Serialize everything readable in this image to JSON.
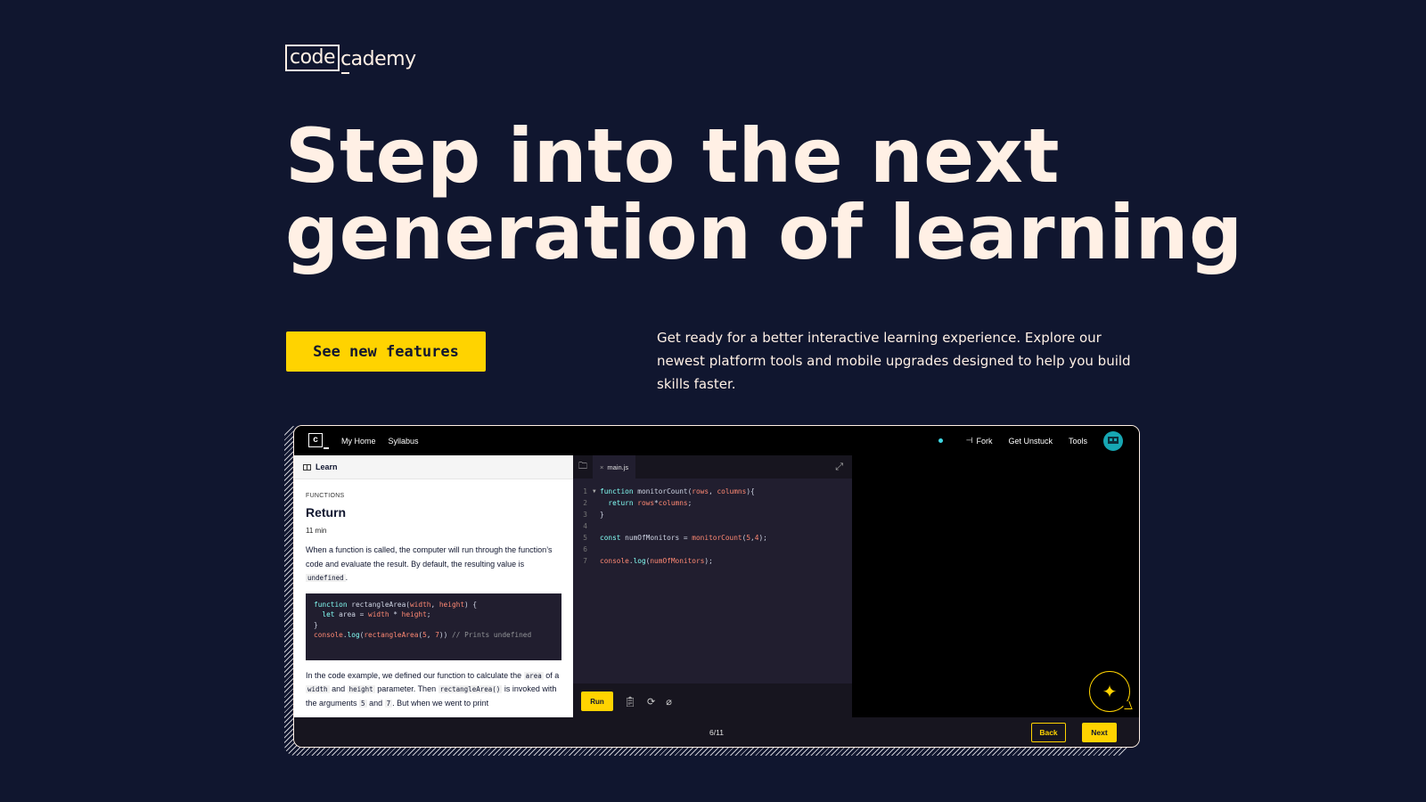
{
  "brand": {
    "logo_box": "code",
    "logo_rest": "cademy"
  },
  "hero": {
    "headline_line1": "Step into the next",
    "headline_line2": "generation of learning",
    "cta_label": "See new features",
    "description": "Get ready for a better interactive learning experience. Explore our newest platform tools and mobile upgrades designed to help you build skills faster."
  },
  "mockup": {
    "topbar": {
      "logo_letter": "c",
      "nav": [
        "My Home",
        "Syllabus"
      ],
      "fork_label": "Fork",
      "get_unstuck_label": "Get Unstuck",
      "tools_label": "Tools"
    },
    "learn": {
      "header_label": "Learn",
      "category": "FUNCTIONS",
      "title": "Return",
      "time": "11 min",
      "para1_a": "When a function is called, the computer will run through the function’s code and evaluate the result. By default, the resulting value is ",
      "para1_code": "undefined",
      "para1_b": ".",
      "code_lines": [
        "function rectangleArea(width, height) {",
        "  let area = width * height;",
        "}",
        "console.log(rectangleArea(5, 7)) // Prints undefined"
      ],
      "para2_a": "In the code example, we defined our function to calculate the ",
      "para2_code1": "area",
      "para2_b": " of a ",
      "para2_code2": "width",
      "para2_c": " and ",
      "para2_code3": "height",
      "para2_d": " parameter. Then ",
      "para2_code4": "rectangleArea()",
      "para2_e": " is invoked with the arguments ",
      "para2_code5": "5",
      "para2_f": " and ",
      "para2_code6": "7",
      "para2_g": ". But when we went to print"
    },
    "editor": {
      "tab_name": "main.js",
      "lines": [
        {
          "n": "1",
          "text": "function monitorCount(rows, columns){"
        },
        {
          "n": "2",
          "text": "  return rows*columns;"
        },
        {
          "n": "3",
          "text": "}"
        },
        {
          "n": "4",
          "text": ""
        },
        {
          "n": "5",
          "text": "const numOfMonitors = monitorCount(5,4);"
        },
        {
          "n": "6",
          "text": ""
        },
        {
          "n": "7",
          "text": "console.log(numOfMonitors);"
        }
      ],
      "run_label": "Run"
    },
    "footer": {
      "progress": "6/11",
      "back_label": "Back",
      "next_label": "Next"
    }
  }
}
